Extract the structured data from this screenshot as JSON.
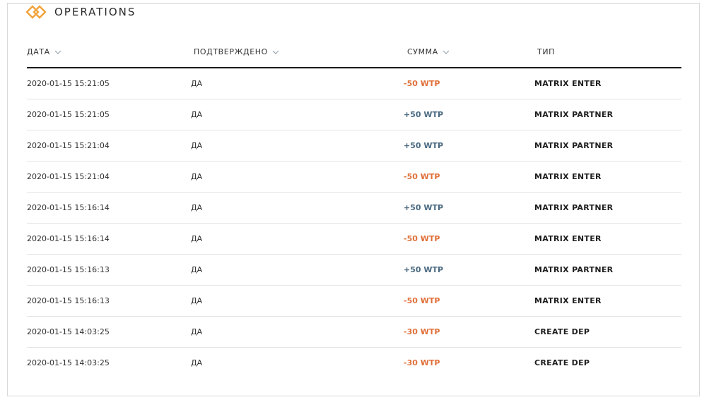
{
  "header": {
    "title": "OPERATIONS",
    "logo_icon": "diamond-logo-icon",
    "accent_color": "#f0a33a"
  },
  "table": {
    "columns": [
      {
        "label": "ДАТА",
        "sortable": true
      },
      {
        "label": "ПОДТВЕРЖДЕНО",
        "sortable": true
      },
      {
        "label": "СУММА",
        "sortable": true
      },
      {
        "label": "ТИП",
        "sortable": false
      }
    ],
    "rows": [
      {
        "date": "2020-01-15 15:21:05",
        "confirmed": "ДА",
        "amount": "-50 WTP",
        "sign": "neg",
        "type": "MATRIX ENTER"
      },
      {
        "date": "2020-01-15 15:21:05",
        "confirmed": "ДА",
        "amount": "+50 WTP",
        "sign": "pos",
        "type": "MATRIX PARTNER"
      },
      {
        "date": "2020-01-15 15:21:04",
        "confirmed": "ДА",
        "amount": "+50 WTP",
        "sign": "pos",
        "type": "MATRIX PARTNER"
      },
      {
        "date": "2020-01-15 15:21:04",
        "confirmed": "ДА",
        "amount": "-50 WTP",
        "sign": "neg",
        "type": "MATRIX ENTER"
      },
      {
        "date": "2020-01-15 15:16:14",
        "confirmed": "ДА",
        "amount": "+50 WTP",
        "sign": "pos",
        "type": "MATRIX PARTNER"
      },
      {
        "date": "2020-01-15 15:16:14",
        "confirmed": "ДА",
        "amount": "-50 WTP",
        "sign": "neg",
        "type": "MATRIX ENTER"
      },
      {
        "date": "2020-01-15 15:16:13",
        "confirmed": "ДА",
        "amount": "+50 WTP",
        "sign": "pos",
        "type": "MATRIX PARTNER"
      },
      {
        "date": "2020-01-15 15:16:13",
        "confirmed": "ДА",
        "amount": "-50 WTP",
        "sign": "neg",
        "type": "MATRIX ENTER"
      },
      {
        "date": "2020-01-15 14:03:25",
        "confirmed": "ДА",
        "amount": "-30 WTP",
        "sign": "neg",
        "type": "CREATE DEP"
      },
      {
        "date": "2020-01-15 14:03:25",
        "confirmed": "ДА",
        "amount": "-30 WTP",
        "sign": "neg",
        "type": "CREATE DEP"
      }
    ],
    "colors": {
      "negative": "#e0703a",
      "positive": "#4a6a82"
    }
  }
}
